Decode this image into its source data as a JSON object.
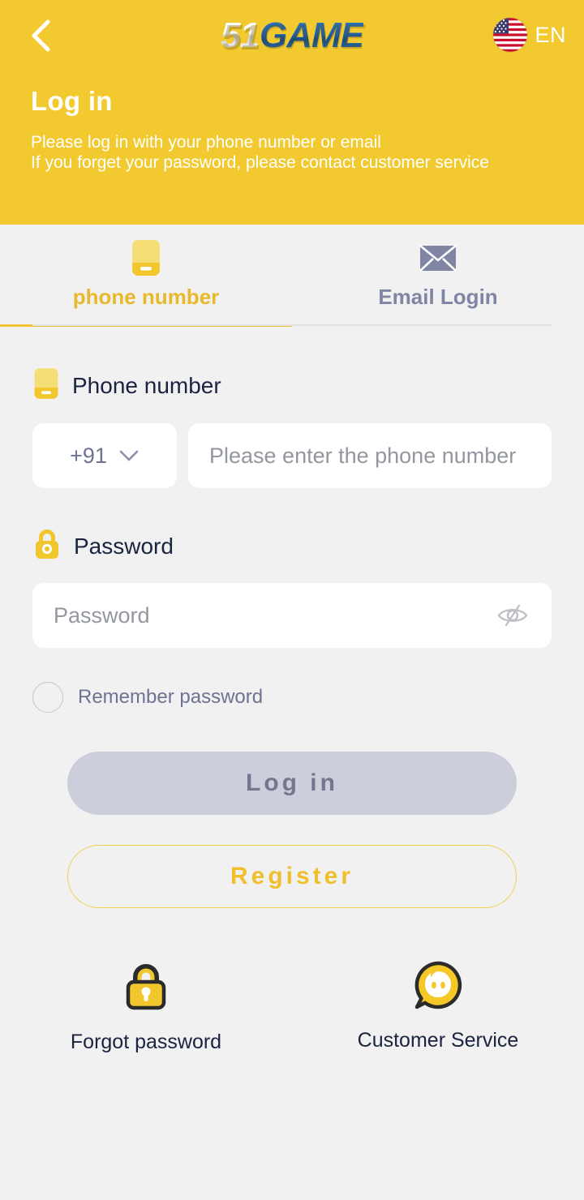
{
  "header": {
    "back_icon": "chevron-left-icon",
    "logo_primary": "51",
    "logo_secondary": "GAME",
    "flag_icon": "us-flag-icon",
    "language": "EN",
    "title": "Log in",
    "subtitle_line1": "Please log in with your phone number or email",
    "subtitle_line2": "If you forget your password, please contact customer service",
    "background_color": "#F2CA30"
  },
  "tabs": [
    {
      "label": "phone number",
      "icon": "phone-icon",
      "active": true,
      "color": "#E8B92B"
    },
    {
      "label": "Email Login",
      "icon": "envelope-icon",
      "active": false,
      "color": "#7F85A3"
    }
  ],
  "form": {
    "phone": {
      "label": "Phone number",
      "label_icon": "phone-icon",
      "country_code": "+91",
      "dropdown_icon": "chevron-down-icon",
      "placeholder": "Please enter the phone number",
      "value": ""
    },
    "password": {
      "label": "Password",
      "label_icon": "lock-icon",
      "placeholder": "Password",
      "value": "",
      "visibility_icon": "eye-off-icon"
    },
    "remember": {
      "label": "Remember password",
      "checked": false
    }
  },
  "buttons": {
    "login": "Log in",
    "login_color": "#CCCEDC",
    "login_text_color": "#73778F",
    "register": "Register",
    "register_color": "#EFBF2D"
  },
  "footer": [
    {
      "label": "Forgot password",
      "icon": "padlock-icon"
    },
    {
      "label": "Customer Service",
      "icon": "support-chat-icon"
    }
  ],
  "colors": {
    "accent_yellow": "#F2CA30",
    "page_background": "#F1F1F1",
    "text_dark": "#1B2340",
    "text_muted": "#6E7392"
  }
}
